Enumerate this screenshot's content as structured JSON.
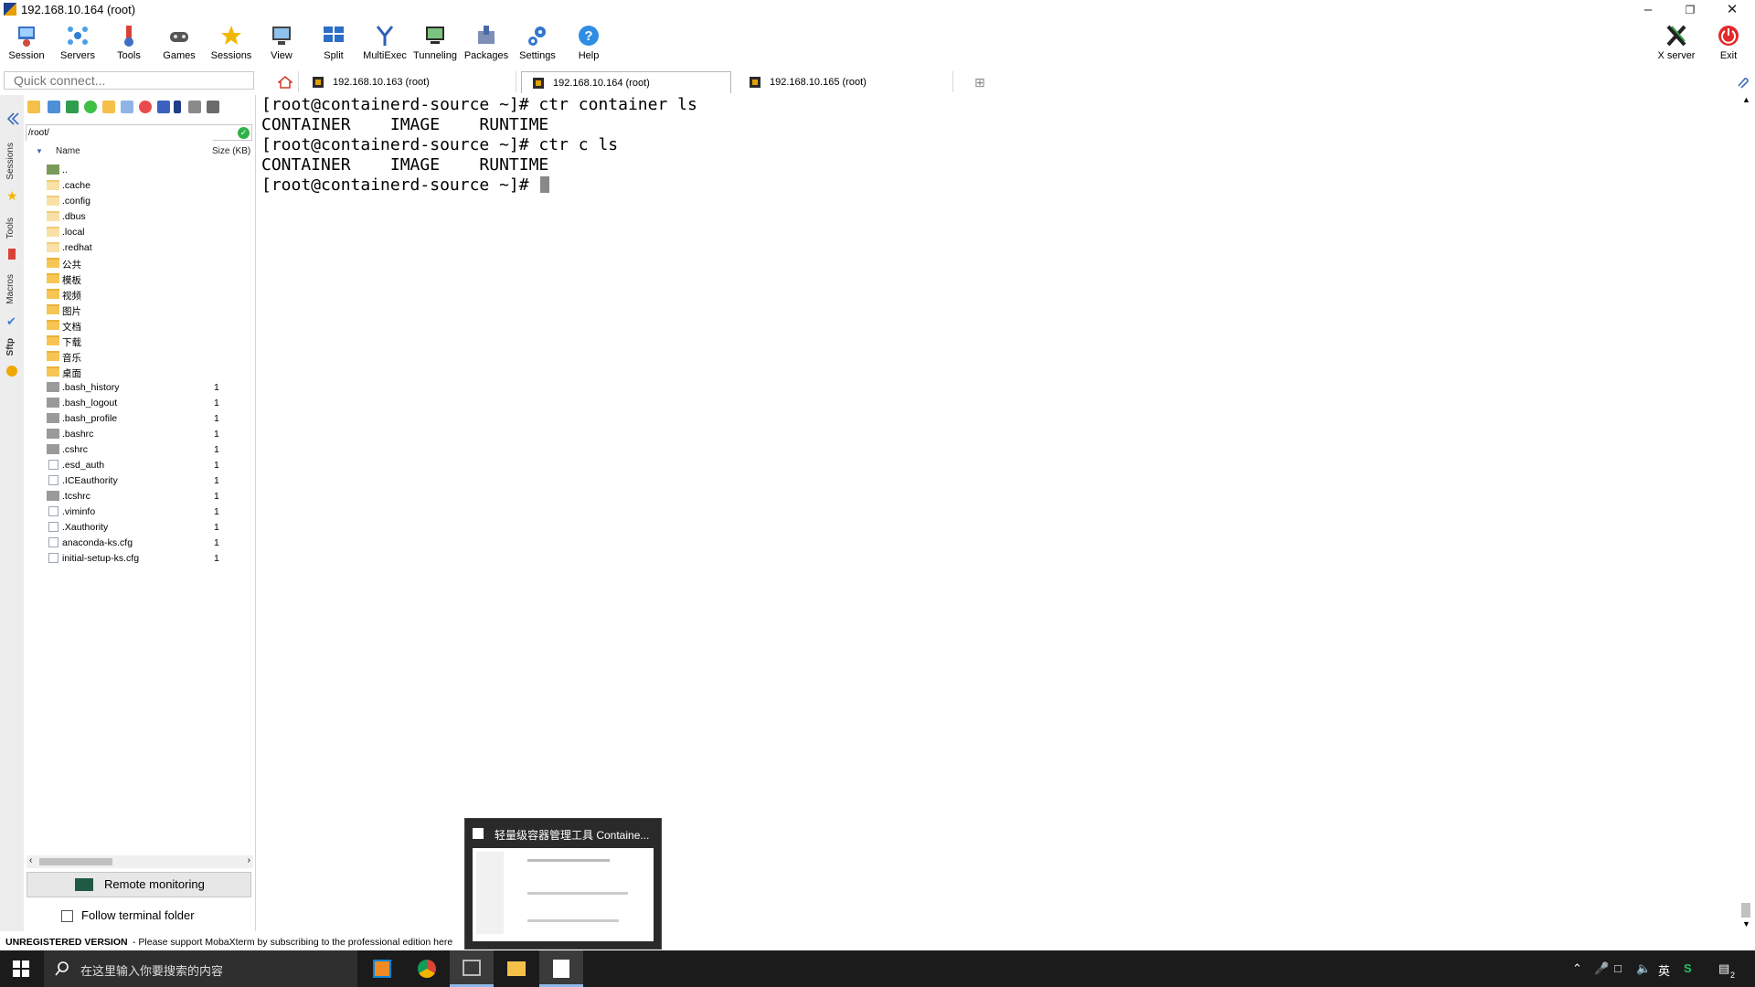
{
  "window": {
    "title": "192.168.10.164 (root)"
  },
  "toolbar": {
    "items": [
      {
        "label": "Session",
        "icon": "session-icon"
      },
      {
        "label": "Servers",
        "icon": "servers-icon"
      },
      {
        "label": "Tools",
        "icon": "tools-icon"
      },
      {
        "label": "Games",
        "icon": "games-icon"
      },
      {
        "label": "Sessions",
        "icon": "star-icon"
      },
      {
        "label": "View",
        "icon": "view-icon"
      },
      {
        "label": "Split",
        "icon": "split-icon"
      },
      {
        "label": "MultiExec",
        "icon": "multiexec-icon"
      },
      {
        "label": "Tunneling",
        "icon": "tunneling-icon"
      },
      {
        "label": "Packages",
        "icon": "packages-icon"
      },
      {
        "label": "Settings",
        "icon": "settings-icon"
      },
      {
        "label": "Help",
        "icon": "help-icon"
      }
    ],
    "xserver": "X server",
    "exit": "Exit"
  },
  "quick_connect": {
    "placeholder": "Quick connect..."
  },
  "tabs": [
    {
      "label": "192.168.10.163 (root)"
    },
    {
      "label": "192.168.10.164 (root)"
    },
    {
      "label": "192.168.10.165 (root)"
    }
  ],
  "side_strip": {
    "sessions": "Sessions",
    "tools": "Tools",
    "macros": "Macros",
    "sftp": "Sftp"
  },
  "sftp": {
    "path": "/root/",
    "col_name": "Name",
    "col_size": "Size (KB)",
    "files": [
      {
        "name": "..",
        "size": "",
        "type": "up"
      },
      {
        "name": ".cache",
        "size": "",
        "type": "folderlight"
      },
      {
        "name": ".config",
        "size": "",
        "type": "folderlight"
      },
      {
        "name": ".dbus",
        "size": "",
        "type": "folderlight"
      },
      {
        "name": ".local",
        "size": "",
        "type": "folderlight"
      },
      {
        "name": ".redhat",
        "size": "",
        "type": "folderlight"
      },
      {
        "name": "公共",
        "size": "",
        "type": "folder"
      },
      {
        "name": "模板",
        "size": "",
        "type": "folder"
      },
      {
        "name": "视频",
        "size": "",
        "type": "folder"
      },
      {
        "name": "图片",
        "size": "",
        "type": "folder"
      },
      {
        "name": "文档",
        "size": "",
        "type": "folder"
      },
      {
        "name": "下载",
        "size": "",
        "type": "folder"
      },
      {
        "name": "音乐",
        "size": "",
        "type": "folder"
      },
      {
        "name": "桌面",
        "size": "",
        "type": "folder"
      },
      {
        "name": ".bash_history",
        "size": "1",
        "type": "file"
      },
      {
        "name": ".bash_logout",
        "size": "1",
        "type": "file"
      },
      {
        "name": ".bash_profile",
        "size": "1",
        "type": "file"
      },
      {
        "name": ".bashrc",
        "size": "1",
        "type": "file"
      },
      {
        "name": ".cshrc",
        "size": "1",
        "type": "file"
      },
      {
        "name": ".esd_auth",
        "size": "1",
        "type": "doc"
      },
      {
        "name": ".ICEauthority",
        "size": "1",
        "type": "doc"
      },
      {
        "name": ".tcshrc",
        "size": "1",
        "type": "file"
      },
      {
        "name": ".viminfo",
        "size": "1",
        "type": "doc"
      },
      {
        "name": ".Xauthority",
        "size": "1",
        "type": "doc"
      },
      {
        "name": "anaconda-ks.cfg",
        "size": "1",
        "type": "doc"
      },
      {
        "name": "initial-setup-ks.cfg",
        "size": "1",
        "type": "doc"
      }
    ],
    "remote_monitoring": "Remote monitoring",
    "follow_terminal": "Follow terminal folder"
  },
  "terminal": {
    "lines": [
      "[root@containerd-source ~]# ctr container ls",
      "CONTAINER    IMAGE    RUNTIME",
      "[root@containerd-source ~]# ctr c ls",
      "CONTAINER    IMAGE    RUNTIME",
      "[root@containerd-source ~]# "
    ]
  },
  "status": {
    "unregistered": "UNREGISTERED VERSION",
    "message": "-  Please support MobaXterm by subscribing to the professional edition here"
  },
  "preview": {
    "title": "轻量级容器管理工具 Containe..."
  },
  "taskbar": {
    "search_placeholder": "在这里输入你要搜索的内容",
    "ime": "英",
    "notif_count": "2"
  },
  "colors": {
    "accent": "#1e6fd0",
    "folder": "#f7c553",
    "taskbar": "#1b1b1b"
  }
}
